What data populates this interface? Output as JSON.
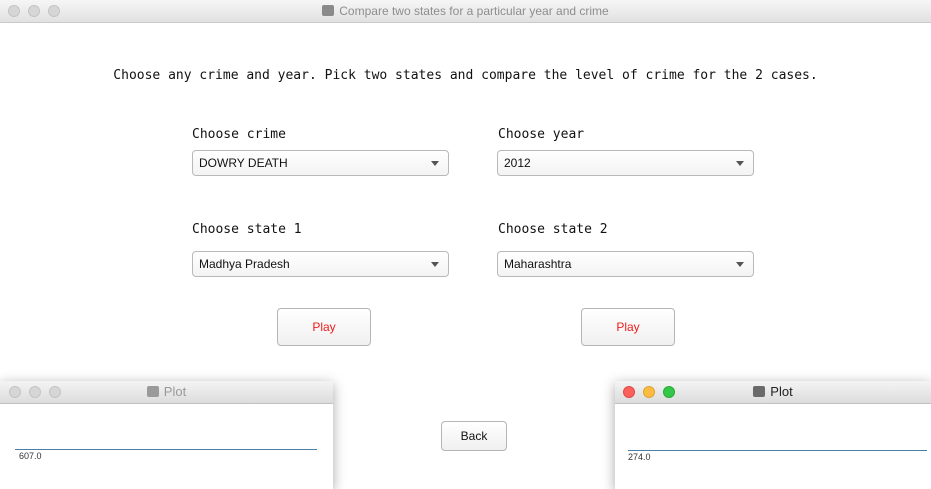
{
  "window": {
    "title": "Compare two states for a particular year and crime"
  },
  "instruction": "Choose any crime and year. Pick two states and compare the level of crime for the 2 cases.",
  "form": {
    "crime_label": "Choose crime",
    "crime_value": "DOWRY DEATH",
    "year_label": "Choose year",
    "year_value": "2012",
    "state1_label": "Choose state 1",
    "state1_value": "Madhya Pradesh",
    "state2_label": "Choose state 2",
    "state2_value": "Maharashtra",
    "play1_label": "Play",
    "play2_label": "Play",
    "back_label": "Back"
  },
  "plot_left": {
    "title": "Plot",
    "value_label": "607.0"
  },
  "plot_right": {
    "title": "Plot",
    "value_label": "274.0"
  },
  "colors": {
    "play_text": "#ee1c1c",
    "plot_line": "#4a7fa6",
    "traffic_close": "#fc605c",
    "traffic_min": "#fdbc40",
    "traffic_max": "#34c84a"
  }
}
